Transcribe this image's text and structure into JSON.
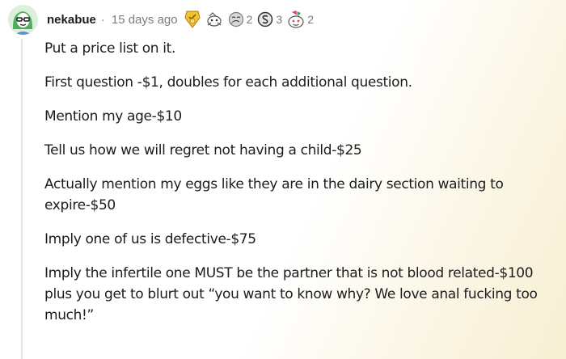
{
  "comment": {
    "author": "nekabue",
    "separator": "·",
    "time": "15 days ago",
    "awards": [
      {
        "icon": "gold-badge-icon",
        "count": ""
      },
      {
        "icon": "rocket-like-icon",
        "count": ""
      },
      {
        "icon": "silver-face-icon",
        "count": "2"
      },
      {
        "icon": "snoo-coin-icon",
        "count": "3"
      },
      {
        "icon": "snoo-party-icon",
        "count": "2"
      }
    ],
    "paragraphs": [
      "Put a price list on it.",
      "First question -$1, doubles for each additional question.",
      "Mention my age-$10",
      "Tell us how we will regret not having a child-$25",
      "Actually mention my eggs like they are in the dairy section waiting to expire-$50",
      "Imply one of us is defective-$75",
      "Imply the infertile one MUST be the partner that is not blood related-$100 plus you get to blurt out “you want to know why? We love anal fucking too much!”"
    ]
  },
  "colors": {
    "text": "#1c1c1c",
    "meta": "#7c7c7c",
    "thread_line": "#e5e5e5",
    "gold": "#f2c230"
  }
}
